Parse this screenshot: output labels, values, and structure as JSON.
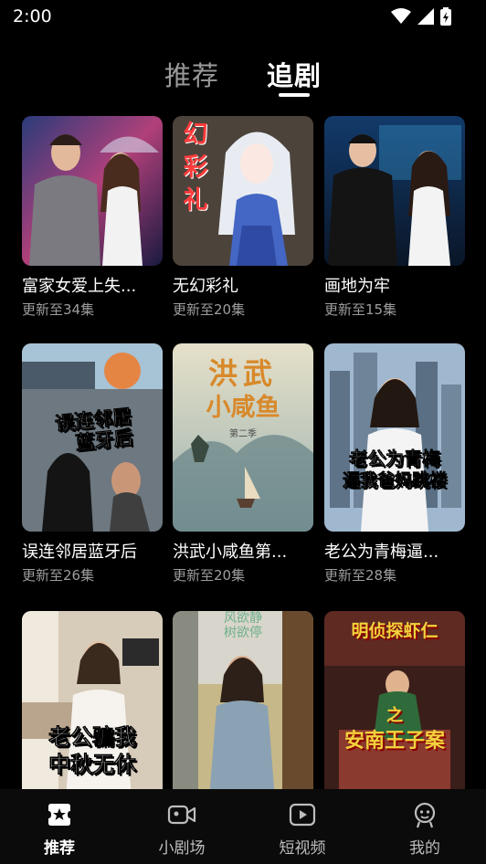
{
  "status_bar": {
    "time": "2:00"
  },
  "top_tabs": {
    "recommend": "推荐",
    "follow": "追剧"
  },
  "dramas": [
    {
      "title": "富家女爱上失...",
      "episodes": "更新至34集"
    },
    {
      "title": "无幻彩礼",
      "episodes": "更新至20集",
      "poster_text": [
        "幻",
        "彩",
        "礼"
      ]
    },
    {
      "title": "画地为牢",
      "episodes": "更新至15集"
    },
    {
      "title": "误连邻居蓝牙后",
      "episodes": "更新至26集",
      "poster_text": [
        "误连邻居",
        "蓝牙后"
      ]
    },
    {
      "title": "洪武小咸鱼第...",
      "episodes": "更新至20集",
      "poster_text": [
        "洪武",
        "小咸鱼",
        "第二季"
      ]
    },
    {
      "title": "老公为青梅逼...",
      "episodes": "更新至28集",
      "poster_text": [
        "老公为青梅",
        "逼我爸妈跳楼"
      ]
    },
    {
      "title": "",
      "episodes": "",
      "poster_text": [
        "老公骗我",
        "中秋无休"
      ]
    },
    {
      "title": "",
      "episodes": "",
      "poster_text": [
        "风欲静",
        "树欲停"
      ]
    },
    {
      "title": "",
      "episodes": "",
      "poster_text": [
        "明侦探虾仁",
        "之",
        "安南王子案"
      ]
    }
  ],
  "bottom_nav": [
    {
      "label": "推荐",
      "icon": "recommend-icon",
      "active": true
    },
    {
      "label": "小剧场",
      "icon": "video-camera-icon",
      "active": false
    },
    {
      "label": "短视频",
      "icon": "play-icon",
      "active": false
    },
    {
      "label": "我的",
      "icon": "profile-icon",
      "active": false
    }
  ]
}
